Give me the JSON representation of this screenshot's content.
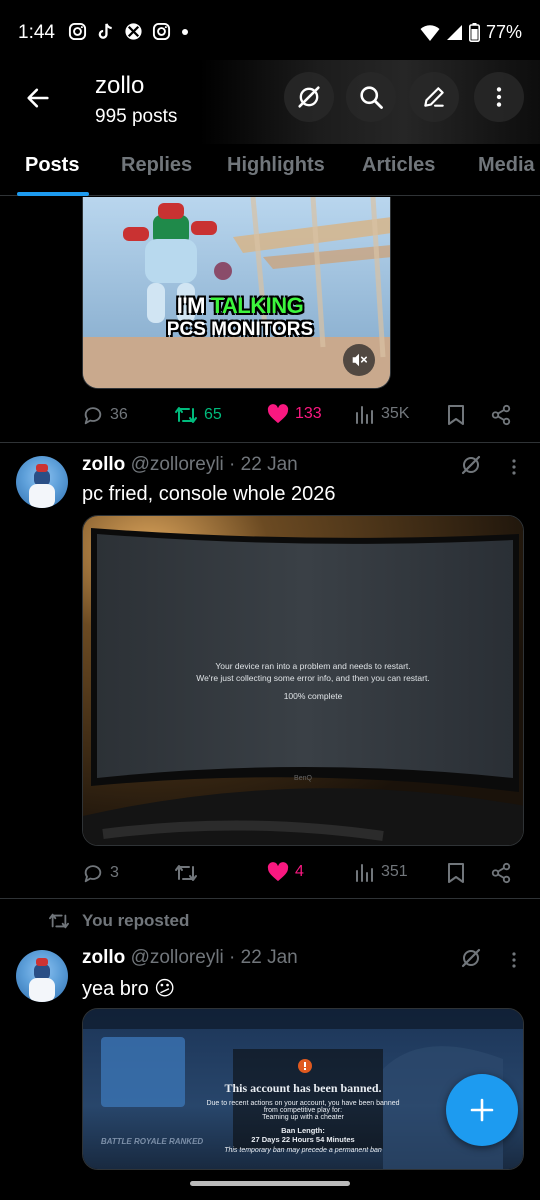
{
  "status_bar": {
    "time": "1:44",
    "battery": "77%",
    "app_icons": [
      "instagram-icon",
      "tiktok-icon",
      "xbox-icon",
      "instagram-icon"
    ]
  },
  "header": {
    "name": "zollo",
    "post_count": "995 posts"
  },
  "tabs": [
    {
      "label": "Posts",
      "active": true
    },
    {
      "label": "Replies",
      "active": false
    },
    {
      "label": "Highlights",
      "active": false
    },
    {
      "label": "Articles",
      "active": false
    },
    {
      "label": "Media",
      "active": false
    }
  ],
  "post1": {
    "caption_line1_white": "I'M",
    "caption_line1_green": "TALKING",
    "caption_line2": "PCS MONITORS",
    "actions": {
      "replies": "36",
      "reposts": "65",
      "likes": "133",
      "views": "35K"
    }
  },
  "post2": {
    "name": "zollo",
    "handle": "@zolloreyli",
    "date": "22 Jan",
    "text": "pc fried, console whole 2026",
    "screen_text": {
      "line1": "Your device ran into a problem and needs to restart.",
      "line2": "We're just collecting some error info, and then you can restart.",
      "line3": "100% complete"
    },
    "actions": {
      "replies": "3",
      "likes": "4",
      "views": "351"
    }
  },
  "post3": {
    "repost_label": "You reposted",
    "name": "zollo",
    "handle": "@zolloreyli",
    "date": "22 Jan",
    "text": "yea bro 😕",
    "ban": {
      "title": "This account has been banned.",
      "line1": "Due to recent actions on your account, you have been banned",
      "line2": "from competitive play for:",
      "line3": "Teaming up with a cheater",
      "length_label": "Ban Length:",
      "length_value": "27 Days 22 Hours 54 Minutes",
      "footer": "This temporary ban may precede a permanent ban",
      "side_label": "BATTLE ROYALE RANKED"
    }
  },
  "colors": {
    "accent": "#1d9bf0",
    "like": "#f91880",
    "repost": "#00ba7c",
    "muted": "#71767b",
    "caption_green": "#3df53d"
  }
}
